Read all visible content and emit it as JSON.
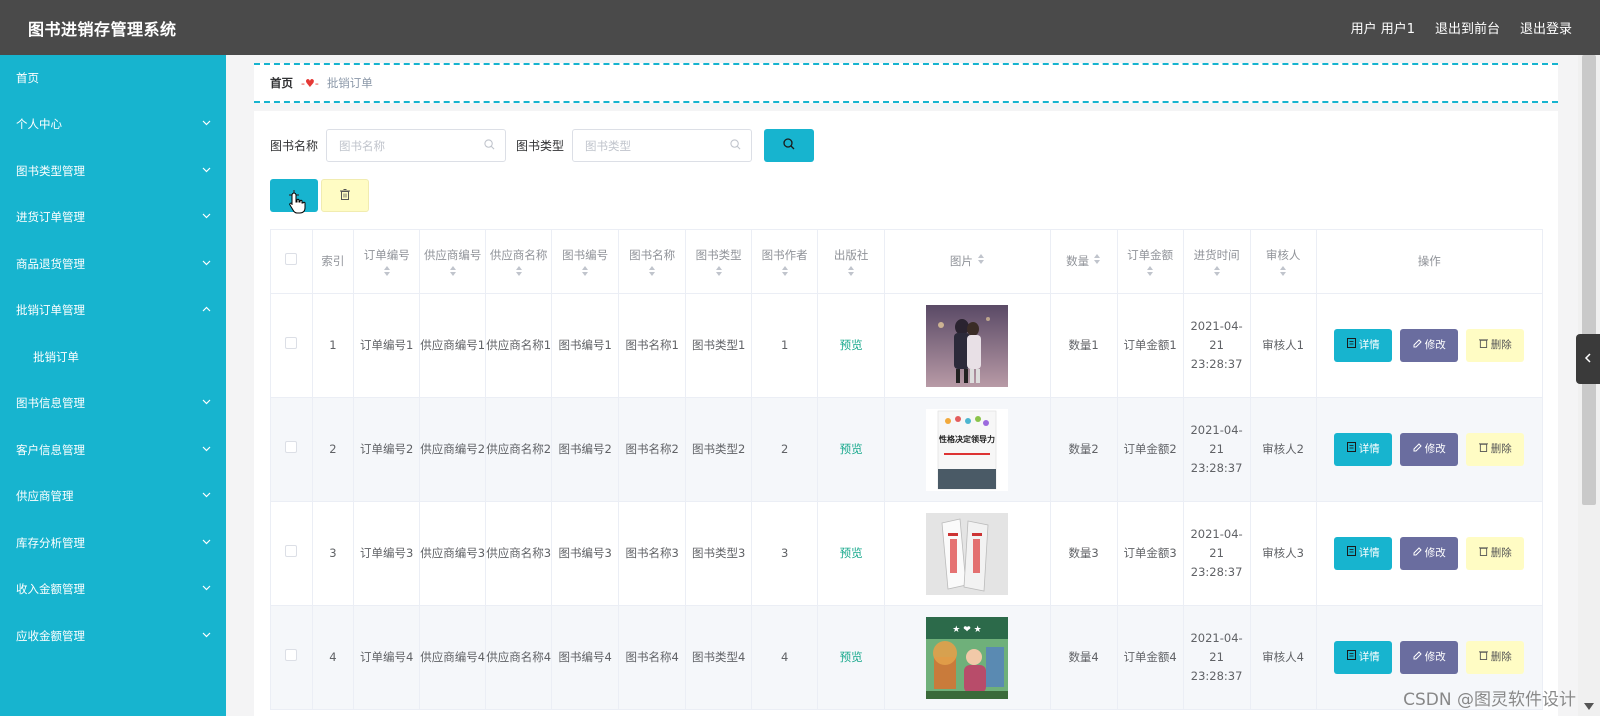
{
  "header": {
    "title": "图书进销存管理系统",
    "links": [
      "用户 用户1",
      "退出到前台",
      "退出登录"
    ]
  },
  "sidebar": {
    "items": [
      {
        "label": "首页",
        "has_chevron": false
      },
      {
        "label": "个人中心",
        "has_chevron": true,
        "chevron": "down"
      },
      {
        "label": "图书类型管理",
        "has_chevron": true,
        "chevron": "down"
      },
      {
        "label": "进货订单管理",
        "has_chevron": true,
        "chevron": "down"
      },
      {
        "label": "商品退货管理",
        "has_chevron": true,
        "chevron": "down"
      },
      {
        "label": "批销订单管理",
        "has_chevron": true,
        "chevron": "up"
      },
      {
        "label": "批销订单",
        "has_chevron": false,
        "sub": true
      },
      {
        "label": "图书信息管理",
        "has_chevron": true,
        "chevron": "down"
      },
      {
        "label": "客户信息管理",
        "has_chevron": true,
        "chevron": "down"
      },
      {
        "label": "供应商管理",
        "has_chevron": true,
        "chevron": "down"
      },
      {
        "label": "库存分析管理",
        "has_chevron": true,
        "chevron": "down"
      },
      {
        "label": "收入金额管理",
        "has_chevron": true,
        "chevron": "down"
      },
      {
        "label": "应收金额管理",
        "has_chevron": true,
        "chevron": "down"
      }
    ]
  },
  "breadcrumb": {
    "home": "首页",
    "separator": "-♥-",
    "current": "批销订单"
  },
  "search": {
    "name_label": "图书名称",
    "name_placeholder": "图书名称",
    "type_label": "图书类型",
    "type_placeholder": "图书类型"
  },
  "table": {
    "columns": [
      "索引",
      "订单编号",
      "供应商编号",
      "供应商名称",
      "图书编号",
      "图书名称",
      "图书类型",
      "图书作者",
      "出版社",
      "图片",
      "数量",
      "订单金额",
      "进货时间",
      "审核人",
      "操作"
    ],
    "rows": [
      {
        "index": "1",
        "order_no": "订单编号1",
        "supplier_no": "供应商编号1",
        "supplier_name": "供应商名称1",
        "book_no": "图书编号1",
        "book_name": "图书名称1",
        "book_type": "图书类型1",
        "author": "1",
        "publisher": "预览",
        "qty": "数量1",
        "amount": "订单金额1",
        "time": "2021-04-21 23:28:37",
        "auditor": "审核人1"
      },
      {
        "index": "2",
        "order_no": "订单编号2",
        "supplier_no": "供应商编号2",
        "supplier_name": "供应商名称2",
        "book_no": "图书编号2",
        "book_name": "图书名称2",
        "book_type": "图书类型2",
        "author": "2",
        "publisher": "预览",
        "qty": "数量2",
        "amount": "订单金额2",
        "time": "2021-04-21 23:28:37",
        "auditor": "审核人2"
      },
      {
        "index": "3",
        "order_no": "订单编号3",
        "supplier_no": "供应商编号3",
        "supplier_name": "供应商名称3",
        "book_no": "图书编号3",
        "book_name": "图书名称3",
        "book_type": "图书类型3",
        "author": "3",
        "publisher": "预览",
        "qty": "数量3",
        "amount": "订单金额3",
        "time": "2021-04-21 23:28:37",
        "auditor": "审核人3"
      },
      {
        "index": "4",
        "order_no": "订单编号4",
        "supplier_no": "供应商编号4",
        "supplier_name": "供应商名称4",
        "book_no": "图书编号4",
        "book_name": "图书名称4",
        "book_type": "图书类型4",
        "author": "4",
        "publisher": "预览",
        "qty": "数量4",
        "amount": "订单金额4",
        "time": "2021-04-21 23:28:37",
        "auditor": "审核人4"
      }
    ],
    "ops": {
      "detail": "详情",
      "edit": "修改",
      "remove": "删除"
    },
    "row2_cover_title": "性格决定领导力"
  },
  "watermark": "CSDN @图灵软件设计",
  "colors": {
    "accent": "#17b4cf",
    "header": "#4a4a4a",
    "edit": "#6a6d9f",
    "remove": "#fffcc4",
    "preview_link": "#17a88c"
  }
}
